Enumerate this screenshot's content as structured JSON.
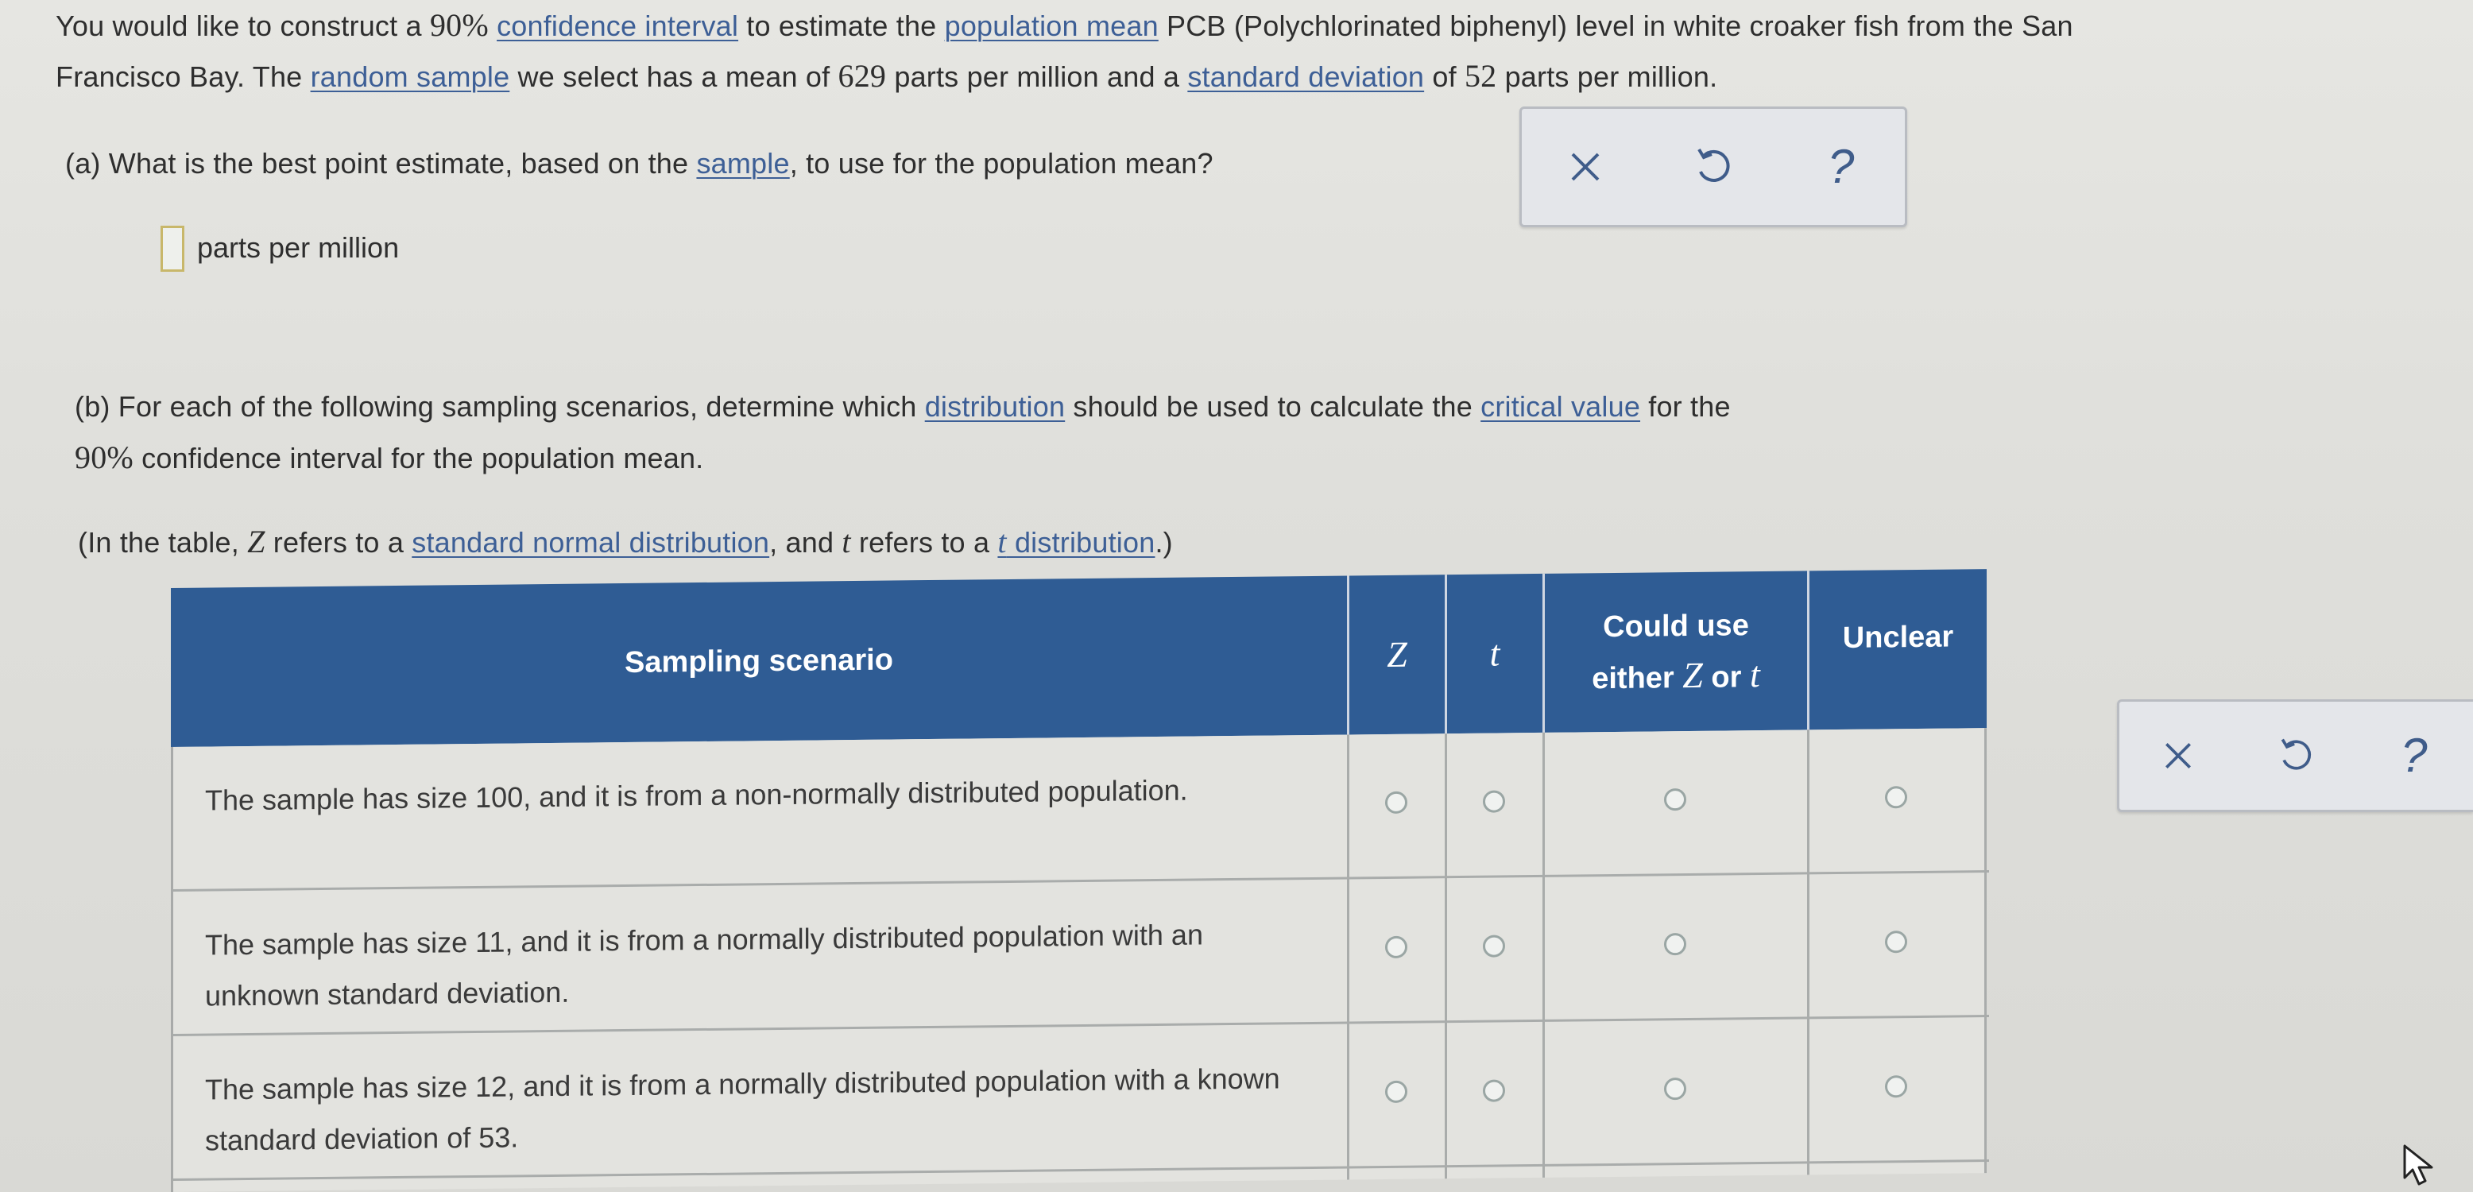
{
  "intro": {
    "line1_a": "You would like to construct a ",
    "line1_pct": "90%",
    "line1_sp1": " ",
    "line1_link1": "confidence interval",
    "line1_b": " to estimate the ",
    "line1_link2": "population mean",
    "line1_c": " PCB (Polychlorinated biphenyl) level in white croaker fish from the San",
    "line2_a": "Francisco Bay. The ",
    "line2_link1": "random sample",
    "line2_b": " we select has a mean of ",
    "line2_mean": "629",
    "line2_c": " parts per million and a ",
    "line2_link2": "standard deviation",
    "line2_d": " of ",
    "line2_sd": "52",
    "line2_e": " parts per million."
  },
  "part_a": {
    "q_a": "(a) What is the best point estimate, based on the ",
    "q_link": "sample",
    "q_b": ", to use for the population mean?",
    "answer_value": "",
    "answer_unit": "parts per million"
  },
  "part_b": {
    "l1_a": "(b) For each of the following sampling scenarios, determine which ",
    "l1_link1": "distribution",
    "l1_b": " should be used to calculate the ",
    "l1_link2": "critical value",
    "l1_c": " for the",
    "l2_pct": "90%",
    "l2_rest": " confidence interval for the population mean.",
    "note_a": "(In the table, ",
    "note_z": "Z",
    "note_b": " refers to a ",
    "note_link1": "standard normal distribution",
    "note_c": ", and ",
    "note_t": "t",
    "note_d": " refers to a ",
    "note_link2_t": "t",
    "note_link2_rest": " distribution",
    "note_e": ".)"
  },
  "tools": {
    "clear_icon": "close-icon",
    "undo_icon": "undo-icon",
    "help_label": "?"
  },
  "table": {
    "headers": {
      "scenario": "Sampling scenario",
      "z": "Z",
      "t": "t",
      "either_line1": "Could use",
      "either_line2_a": "either ",
      "either_z": "Z",
      "either_or": " or ",
      "either_t": "t",
      "unclear": "Unclear"
    },
    "rows": [
      {
        "text": "The sample has size 100, and it is from a non-normally distributed population.",
        "selected": null
      },
      {
        "text": "The sample has size 11, and it is from a normally distributed population with an unknown standard deviation.",
        "selected": null
      },
      {
        "text": "The sample has size 12, and it is from a normally distributed population with a known standard deviation of 53.",
        "selected": null
      }
    ]
  },
  "colors": {
    "header_bg": "#2f5c94",
    "link": "#3d5f96",
    "tool_icon": "#3f5c8a"
  }
}
